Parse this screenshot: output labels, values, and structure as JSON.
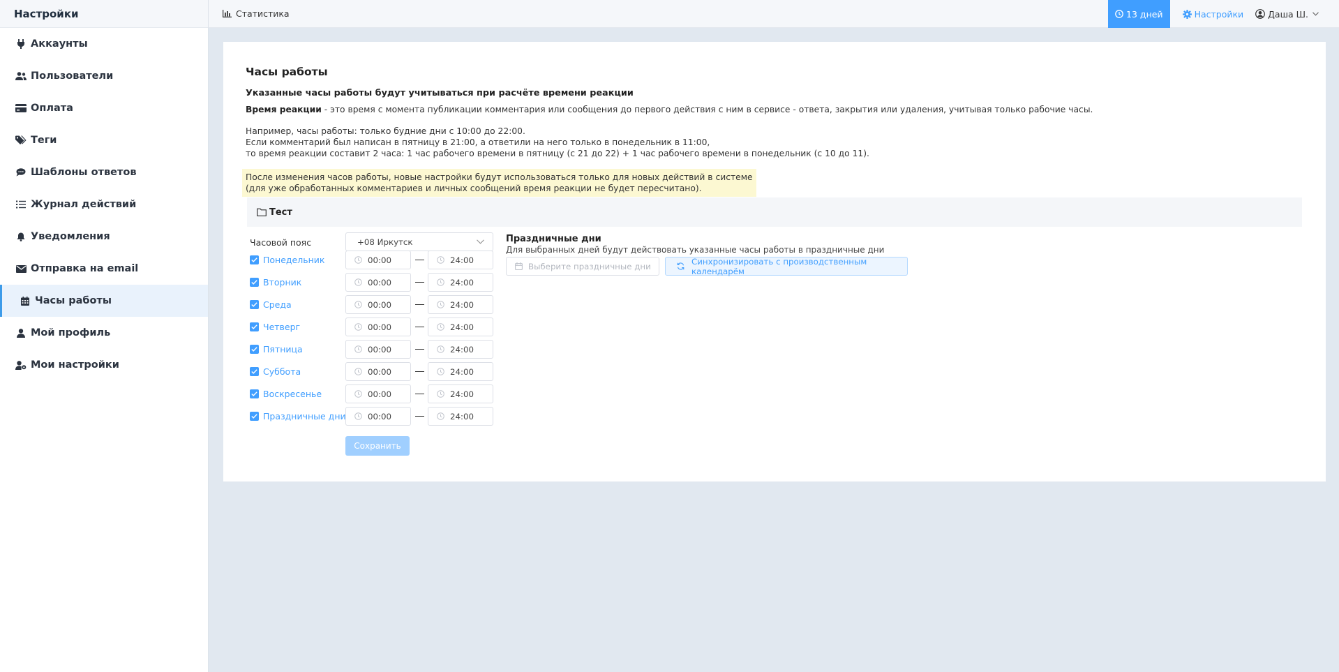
{
  "sidebar": {
    "title": "Настройки",
    "items": [
      {
        "label": "Аккаунты",
        "icon": "plug-icon"
      },
      {
        "label": "Пользователи",
        "icon": "users-icon"
      },
      {
        "label": "Оплата",
        "icon": "credit-card-icon"
      },
      {
        "label": "Теги",
        "icon": "tags-icon"
      },
      {
        "label": "Шаблоны ответов",
        "icon": "comments-icon"
      },
      {
        "label": "Журнал действий",
        "icon": "list-icon"
      },
      {
        "label": "Уведомления",
        "icon": "bell-icon"
      },
      {
        "label": "Отправка на email",
        "icon": "envelope-icon"
      },
      {
        "label": "Часы работы",
        "icon": "calendar-icon",
        "active": true
      },
      {
        "label": "Мой профиль",
        "icon": "user-icon"
      },
      {
        "label": "Мои настройки",
        "icon": "user-cog-icon"
      }
    ]
  },
  "topbar": {
    "statistics": "Статистика",
    "days": "13 дней",
    "settings": "Настройки",
    "user": "Даша Ш."
  },
  "main": {
    "title": "Часы работы",
    "subtitle": "Указанные часы работы будут учитываться при расчёте времени реакции",
    "definition_term": "Время реакции",
    "definition_text": " - это время с момента публикации комментария или сообщения до первого действия с ним в сервисе - ответа, закрытия или удаления, учитывая только рабочие часы.",
    "example": [
      "Например, часы работы: только будние дни с 10:00 до 22:00.",
      "Если комментарий был написан в пятницу в 21:00, а ответили на него только в понедельник в 11:00,",
      "то время реакции составит 2 часа: 1 час рабочего времени в пятницу (с 21 до 22) + 1 час рабочего времени в понедельник (с 10 до 11)."
    ],
    "warning": [
      "После изменения часов работы, новые настройки будут использоваться только для новых действий в системе",
      "(для уже обработанных комментариев и личных сообщений время реакции не будет пересчитано)."
    ],
    "group": "Тест",
    "timezone_label": "Часовой пояс",
    "timezone_value": "+08 Иркутск",
    "days": [
      {
        "label": "Понедельник",
        "checked": true,
        "from": "00:00",
        "to": "24:00"
      },
      {
        "label": "Вторник",
        "checked": true,
        "from": "00:00",
        "to": "24:00"
      },
      {
        "label": "Среда",
        "checked": true,
        "from": "00:00",
        "to": "24:00"
      },
      {
        "label": "Четверг",
        "checked": true,
        "from": "00:00",
        "to": "24:00"
      },
      {
        "label": "Пятница",
        "checked": true,
        "from": "00:00",
        "to": "24:00"
      },
      {
        "label": "Суббота",
        "checked": true,
        "from": "00:00",
        "to": "24:00"
      },
      {
        "label": "Воскресенье",
        "checked": true,
        "from": "00:00",
        "to": "24:00"
      },
      {
        "label": "Праздничные дни",
        "checked": true,
        "from": "00:00",
        "to": "24:00"
      }
    ],
    "save": "Сохранить",
    "holidays": {
      "title": "Праздничные дни",
      "description": "Для выбранных дней будут действовать указанные часы работы в праздничные дни",
      "placeholder": "Выберите праздничные дни",
      "sync": "Синхронизировать с производственным календарём"
    }
  },
  "colors": {
    "accent": "#409eff",
    "sidebar_active": "#e9f2fc",
    "warning_bg": "#fcf8d2",
    "page_bg": "#e1e8f0"
  }
}
